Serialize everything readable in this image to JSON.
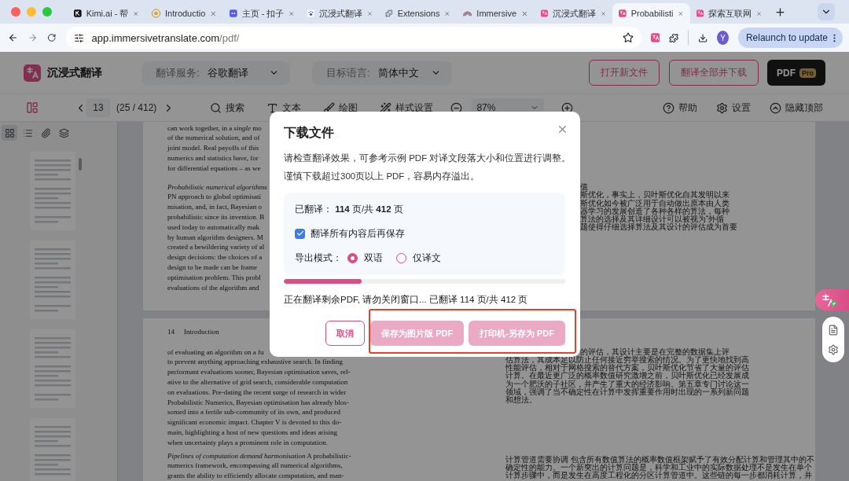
{
  "browser": {
    "tabs": [
      {
        "title": "Kimi.ai - 帮",
        "kind": "dark",
        "selected": false
      },
      {
        "title": "Introductio",
        "kind": "emblem",
        "selected": false
      },
      {
        "title": "主页 - 扣子",
        "kind": "bot",
        "selected": false
      },
      {
        "title": "沉浸式翻译",
        "kind": "paw",
        "selected": false
      },
      {
        "title": "Extensions",
        "kind": "puzzle",
        "selected": false
      },
      {
        "title": "Immersive",
        "kind": "rainbow",
        "selected": false
      },
      {
        "title": "沉浸式翻译",
        "kind": "translate",
        "selected": false
      },
      {
        "title": "Probabilisti",
        "kind": "translate",
        "selected": true
      },
      {
        "title": "探索互联网",
        "kind": "translate",
        "selected": false
      }
    ],
    "address": {
      "host": "app.immersivetranslate.com",
      "path": "/pdf/"
    },
    "avatar": "Y",
    "update_button": "Relaunch to update"
  },
  "app": {
    "name": "沉浸式翻译",
    "selects": [
      {
        "label": "翻译服务:",
        "value": "谷歌翻译"
      },
      {
        "label": "目标语言:",
        "value": "简体中文"
      }
    ],
    "buttons": [
      "打开新文件",
      "翻译全部并下载"
    ],
    "pdf_button": {
      "label": "PDF",
      "badge": "Pro"
    }
  },
  "toolbar": {
    "page_input": "13",
    "page_count": "(25 / 412)",
    "tools": [
      {
        "kind": "search",
        "label": "搜索"
      },
      {
        "kind": "text",
        "label": "文本"
      },
      {
        "kind": "draw",
        "label": "绘图"
      },
      {
        "kind": "style",
        "label": "样式设置"
      }
    ],
    "zoom": "87%",
    "right_tools": [
      {
        "kind": "help",
        "label": "帮助"
      },
      {
        "kind": "settings",
        "label": "设置"
      },
      {
        "kind": "hide",
        "label": "隐藏顶部"
      }
    ]
  },
  "sidebar": {
    "views": [
      {
        "kind": "grid",
        "selected": true
      },
      {
        "kind": "list",
        "selected": false
      },
      {
        "kind": "attachments",
        "selected": false
      },
      {
        "kind": "layers",
        "selected": false
      }
    ]
  },
  "pages": [
    {
      "left": [
        [
          "can work together, in a *single* mo",
          "of the numerical solution, and of",
          "joint model. Real payoffs of this",
          "numerics and statistics have, for",
          "for differential equations – as we"
        ],
        [
          "*Probabilistic numerical algorithms*",
          "PN approach to global optimisati",
          "misation, and, in fact, Bayesian o",
          "probabilistic since its invention. B",
          "used today to automatically mak",
          "by human algorithm designers. M",
          "created a bewildering variety of al",
          "design decisions: the choices of a",
          "design to be made can be frame",
          "optimisation problem. This probl",
          "evaluations of the algorithm and"
        ]
      ],
      "right_covered": [
        "值",
        "斯优化，事实上，贝叶斯优化自其发明以来",
        "斯优化如今被广泛用于自动做出原本由人类",
        "器学习的发展创造了各种各样的算法，每种",
        "算法的选择及其详细设计可以被视为“外循",
        "题使得仔细选择算法及其设计的评估成为首要"
      ]
    },
    {
      "running_head": {
        "number": "14",
        "title": "Introduction"
      },
      "left": [
        [
          "of evaluating an algorithm on a fu",
          "to prevent anything approaching exhaustive search. In finding",
          "performant evaluations sooner, Bayesian optimisation saves, rel-",
          "ative to the alternative of grid search, considerable computation",
          "on evaluations. Pre-dating the recent surge of research in wider",
          "Probabilistic Numerics, Bayesian optimisation has already blos-",
          "somed into a fertile sub-community of its own, and produced",
          "significant economic impact. Chapter V is devoted to this do-",
          "main, highlighting a host of new questions and ideas arising",
          "when uncertainty plays a prominent role in computation."
        ],
        [
          "*Pipelines of computation demand harmonisation*   A probabilistic-",
          "numerics framework, encompassing all numerical algorithms,",
          "grants the ability to efficiently allocate computation, and man-"
        ]
      ],
      "right_covered": [
        "的评估，其设计主要是在完整的数据集上评"
      ],
      "right": [
        [
          "估算法，其成本足以防止任何接近穷举搜索的情况。为了更快地找到高",
          "性能评估，相对于网格搜索的替代方案，贝叶斯优化节省了大量的评估",
          "计算。在最近更广泛的概率数值研究激增之前，贝叶斯优化已经发展成",
          "为一个肥沃的子社区，并产生了重大的经济影响。第五章专门讨论这一",
          "领域，强调了当不确定性在计算中发挥重要作用时出现的一系列新问题",
          "和想法。"
        ],
        [
          "计算管道需要协调 包含所有数值算法的概率数值框架赋予了有效分配计算和管理其中的不",
          "确定性的能力。一个新突出的计算问题是，科学和工业中的实际数据处理不是发生在单个",
          "计算步骤中，而是发生在高度工程化的分区计算管道中。这些链的每一步都消耗计算，并"
        ]
      ]
    }
  ],
  "dialog": {
    "title": "下载文件",
    "notes": [
      "请检查翻译效果，可参考示例 PDF 对译文段落大小和位置进行调整。",
      "谨慎下载超过300页以上 PDF，容易内存溢出。"
    ],
    "summary": "已翻译： **114** 页/共 **412** 页",
    "option": {
      "label": "翻译所有内容后再保存",
      "checked": true
    },
    "mode": {
      "label": "导出模式：",
      "options": [
        {
          "label": "双语",
          "selected": true
        },
        {
          "label": "仅译文",
          "selected": false
        }
      ]
    },
    "progress": {
      "level": 0.277
    },
    "status": "正在翻译剩余PDF, 请勿关闭窗口... 已翻译 114 页/共 412 页",
    "buttons": [
      {
        "kind": "cancel",
        "label": "取消",
        "disabled": false
      },
      {
        "kind": "primary",
        "label": "保存为图片版 PDF",
        "disabled": true
      },
      {
        "kind": "primary",
        "label": "打印机-另存为 PDF",
        "disabled": true
      }
    ]
  }
}
